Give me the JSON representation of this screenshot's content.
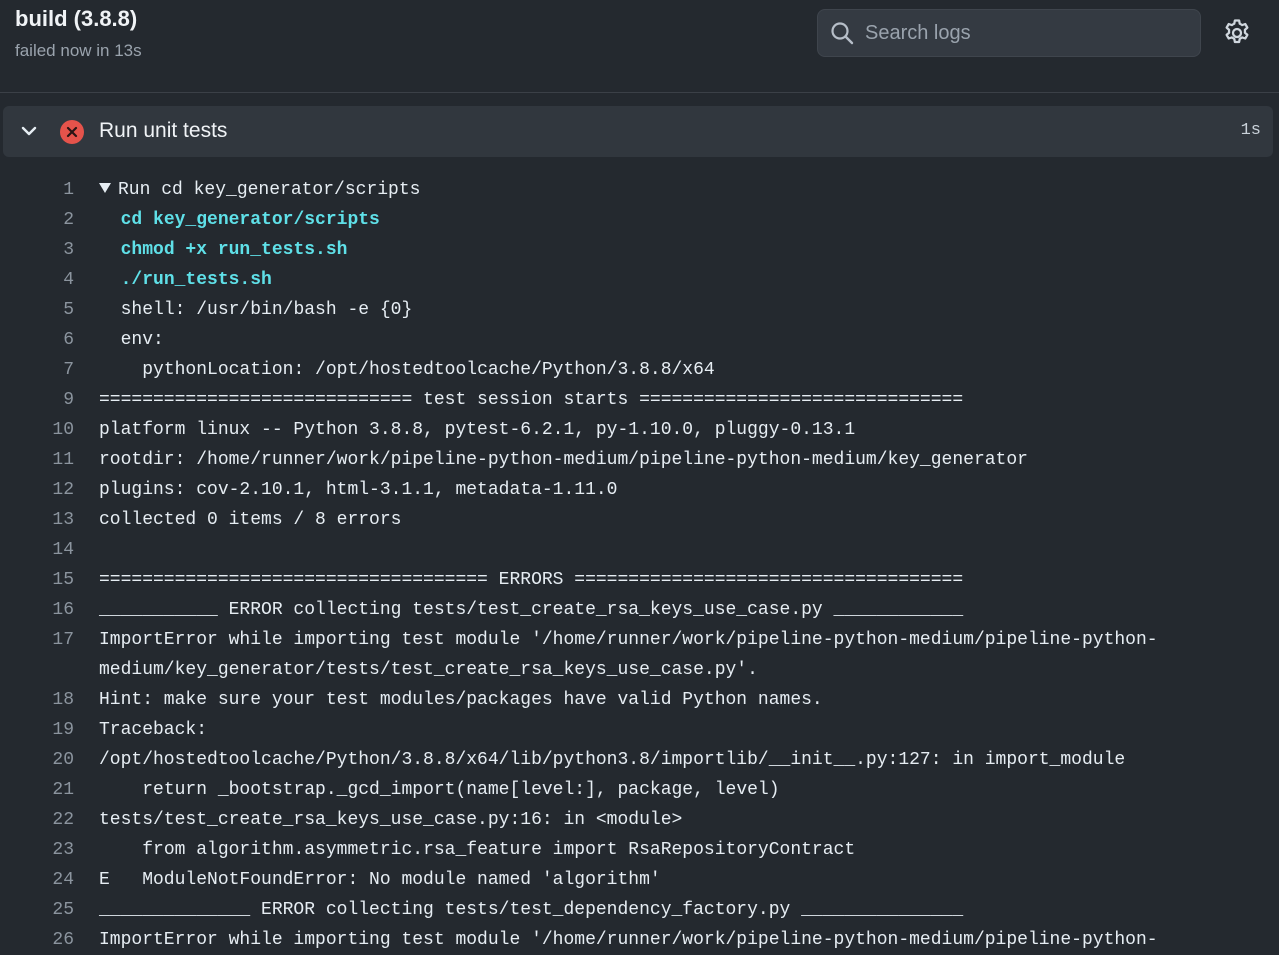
{
  "job": {
    "title": "build (3.8.8)",
    "status": "failed now in 13s"
  },
  "search": {
    "placeholder": "Search logs",
    "value": ""
  },
  "icons": {
    "search": "search-icon",
    "settings": "gear-icon",
    "expand": "chevron-down-icon",
    "status": "x-circle-fail-icon"
  },
  "colors": {
    "background": "#24292f",
    "step_header": "#31373e",
    "fail": "#e5534b",
    "command": "#5fe0e8",
    "line_number": "#8b949e"
  },
  "step": {
    "name": "Run unit tests",
    "duration": "1s",
    "status": "failed"
  },
  "log": {
    "lines": [
      {
        "n": "1",
        "text": "Run cd key_generator/scripts",
        "collapsible": true
      },
      {
        "n": "2",
        "text": "  cd key_generator/scripts",
        "cmd": true
      },
      {
        "n": "3",
        "text": "  chmod +x run_tests.sh",
        "cmd": true
      },
      {
        "n": "4",
        "text": "  ./run_tests.sh",
        "cmd": true
      },
      {
        "n": "5",
        "text": "  shell: /usr/bin/bash -e {0}"
      },
      {
        "n": "6",
        "text": "  env:"
      },
      {
        "n": "7",
        "text": "    pythonLocation: /opt/hostedtoolcache/Python/3.8.8/x64"
      },
      {
        "n": "9",
        "text": "============================= test session starts =============================="
      },
      {
        "n": "10",
        "text": "platform linux -- Python 3.8.8, pytest-6.2.1, py-1.10.0, pluggy-0.13.1"
      },
      {
        "n": "11",
        "text": "rootdir: /home/runner/work/pipeline-python-medium/pipeline-python-medium/key_generator"
      },
      {
        "n": "12",
        "text": "plugins: cov-2.10.1, html-3.1.1, metadata-1.11.0"
      },
      {
        "n": "13",
        "text": "collected 0 items / 8 errors"
      },
      {
        "n": "14",
        "text": ""
      },
      {
        "n": "15",
        "text": "==================================== ERRORS ===================================="
      },
      {
        "n": "16",
        "text": "___________ ERROR collecting tests/test_create_rsa_keys_use_case.py ____________"
      },
      {
        "n": "17",
        "text": "ImportError while importing test module '/home/runner/work/pipeline-python-medium/pipeline-python-medium/key_generator/tests/test_create_rsa_keys_use_case.py'."
      },
      {
        "n": "18",
        "text": "Hint: make sure your test modules/packages have valid Python names."
      },
      {
        "n": "19",
        "text": "Traceback:"
      },
      {
        "n": "20",
        "text": "/opt/hostedtoolcache/Python/3.8.8/x64/lib/python3.8/importlib/__init__.py:127: in import_module"
      },
      {
        "n": "21",
        "text": "    return _bootstrap._gcd_import(name[level:], package, level)"
      },
      {
        "n": "22",
        "text": "tests/test_create_rsa_keys_use_case.py:16: in <module>"
      },
      {
        "n": "23",
        "text": "    from algorithm.asymmetric.rsa_feature import RsaRepositoryContract"
      },
      {
        "n": "24",
        "text": "E   ModuleNotFoundError: No module named 'algorithm'"
      },
      {
        "n": "25",
        "text": "______________ ERROR collecting tests/test_dependency_factory.py _______________"
      },
      {
        "n": "26",
        "text": "ImportError while importing test module '/home/runner/work/pipeline-python-medium/pipeline-python-"
      }
    ]
  }
}
